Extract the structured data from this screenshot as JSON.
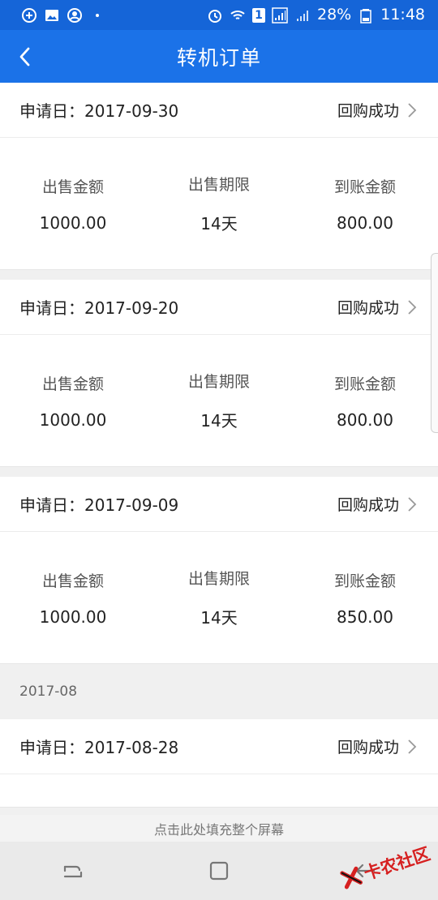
{
  "status_bar": {
    "battery": "28%",
    "time": "11:48",
    "sim_badge": "1"
  },
  "header": {
    "title": "转机订单"
  },
  "orders": [
    {
      "apply_date": "申请日：2017-09-30",
      "status": "回购成功",
      "cols": [
        {
          "label": "出售金额",
          "value": "1000.00"
        },
        {
          "label": "出售期限",
          "value": "14天"
        },
        {
          "label": "到账金额",
          "value": "800.00"
        }
      ]
    },
    {
      "apply_date": "申请日：2017-09-20",
      "status": "回购成功",
      "cols": [
        {
          "label": "出售金额",
          "value": "1000.00"
        },
        {
          "label": "出售期限",
          "value": "14天"
        },
        {
          "label": "到账金额",
          "value": "800.00"
        }
      ]
    },
    {
      "apply_date": "申请日：2017-09-09",
      "status": "回购成功",
      "cols": [
        {
          "label": "出售金额",
          "value": "1000.00"
        },
        {
          "label": "出售期限",
          "value": "14天"
        },
        {
          "label": "到账金额",
          "value": "850.00"
        }
      ]
    },
    {
      "apply_date": "申请日：2017-08-28",
      "status": "回购成功"
    }
  ],
  "month_separator": "2017-08",
  "fill_screen_prompt": "点击此处填充整个屏幕",
  "watermark": "卡农社区",
  "colors": {
    "header_blue": "#1b72e8",
    "status_blue": "#1565d8",
    "watermark_red": "#d62020"
  }
}
